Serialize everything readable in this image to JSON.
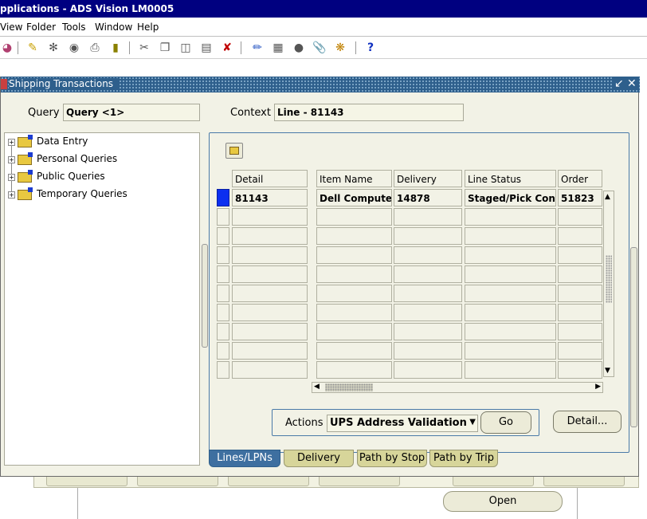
{
  "app": {
    "title": "pplications - ADS Vision LM0005"
  },
  "menu": {
    "view": "View",
    "folder": "Folder",
    "tools": "Tools",
    "window": "Window",
    "help": "Help"
  },
  "toolbar": {
    "help_glyph": "?"
  },
  "window": {
    "title": "Shipping Transactions",
    "query_label": "Query",
    "query_value": "Query <1>",
    "context_label": "Context",
    "context_value": "Line - 81143"
  },
  "tree": {
    "items": [
      {
        "label": "Data Entry"
      },
      {
        "label": "Personal Queries"
      },
      {
        "label": "Public Queries"
      },
      {
        "label": "Temporary Queries"
      }
    ]
  },
  "table": {
    "columns": [
      "Detail",
      "Item Name",
      "Delivery",
      "Line Status",
      "Order"
    ],
    "rows": [
      [
        "81143",
        "Dell Computer",
        "14878",
        "Staged/Pick Conf",
        "51823"
      ]
    ],
    "empty_rows": 9
  },
  "actions": {
    "label": "Actions",
    "selected": "UPS Address Validation",
    "go_label": "Go",
    "detail_label": "Detail..."
  },
  "tabs": [
    {
      "label": "Lines/LPNs",
      "active": true
    },
    {
      "label": "Delivery",
      "active": false
    },
    {
      "label": "Path by Stop",
      "active": false
    },
    {
      "label": "Path by Trip",
      "active": false
    }
  ],
  "background": {
    "open_label": "Open"
  },
  "colors": {
    "title_bar": "#000080",
    "window_title": "#2e5f8c",
    "selected_row": "#0c2ff0",
    "tab_active": "#3e6fa0",
    "tab_inactive": "#d7d59a"
  }
}
